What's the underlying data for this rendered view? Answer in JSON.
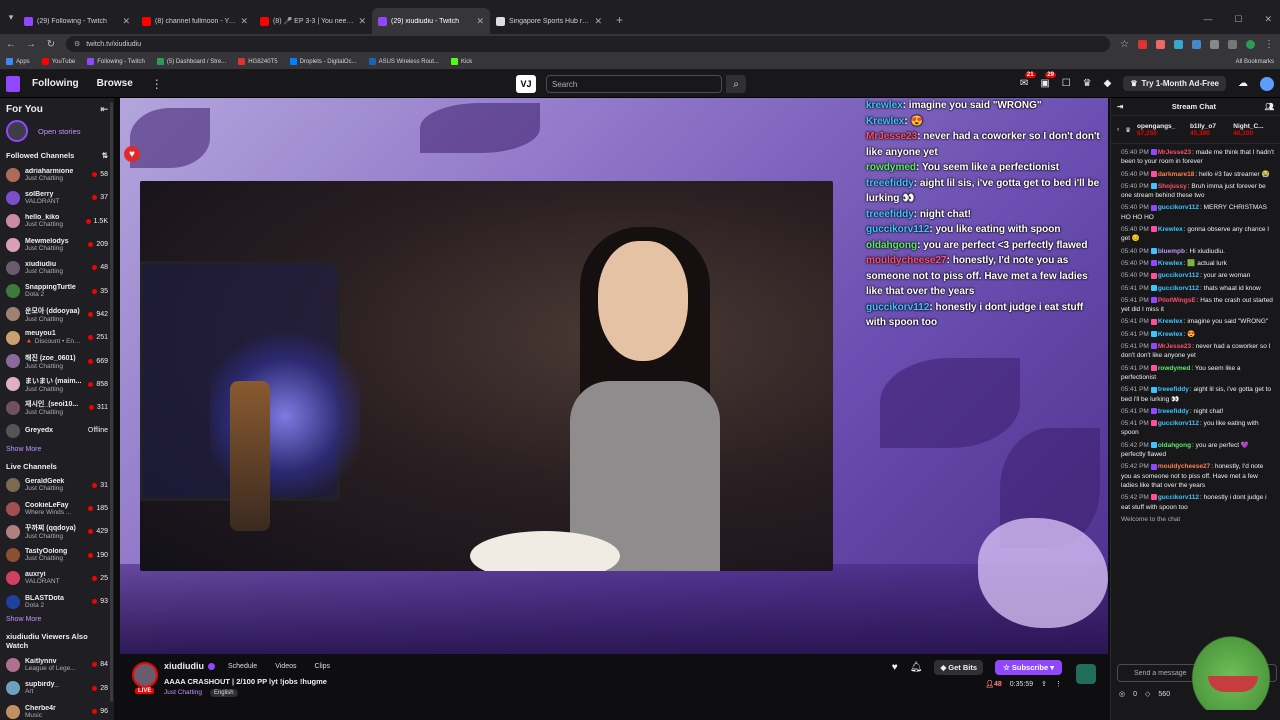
{
  "browser": {
    "tabs": [
      {
        "title": "(29) Following - Twitch",
        "color": "#9147ff",
        "active": false
      },
      {
        "title": "(8) channel fullmoon - YouTube",
        "color": "#ff0000",
        "active": false
      },
      {
        "title": "(8) 🎤 EP 3-3 | You need to l",
        "color": "#ff0000",
        "active": false
      },
      {
        "title": "(29) xiudiudiu - Twitch",
        "color": "#9147ff",
        "active": true
      },
      {
        "title": "Singapore Sports Hub rename",
        "color": "#dddddd",
        "active": false
      }
    ],
    "url": "twitch.tv/xiudiudiu",
    "bookmarks": [
      {
        "label": "Apps",
        "color": "#4285f4"
      },
      {
        "label": "YouTube",
        "color": "#ff0000"
      },
      {
        "label": "Following - Twitch",
        "color": "#9147ff"
      },
      {
        "label": "(5) Dashboard / Stre...",
        "color": "#2d9b55"
      },
      {
        "label": "HG8240T5",
        "color": "#d33"
      },
      {
        "label": "Droplets - DigitalOc...",
        "color": "#0080ff"
      },
      {
        "label": "ASUS Wireless Rout...",
        "color": "#1d63ae"
      },
      {
        "label": "Kick",
        "color": "#53fc18"
      }
    ],
    "all_bookmarks": "All Bookmarks"
  },
  "topnav": {
    "following": "Following",
    "browse": "Browse",
    "vj": "VJ",
    "search_placeholder": "Search",
    "notif_badge_1": "21",
    "notif_badge_2": "29",
    "prime": "Try 1-Month Ad-Free"
  },
  "sidebar": {
    "for_you": "For You",
    "open_stories": "Open stories",
    "followed_title": "Followed Channels",
    "followed": [
      {
        "name": "adriaharmione",
        "cat": "Just Chatting",
        "viewers": "58",
        "color": "#b06a5a"
      },
      {
        "name": "soIBerry",
        "cat": "VALORANT",
        "viewers": "37",
        "color": "#7a4fc9"
      },
      {
        "name": "hello_kiko",
        "cat": "Just Chatting",
        "viewers": "1.5K",
        "color": "#c98ca0"
      },
      {
        "name": "Mewmelodys",
        "cat": "Just Chatting",
        "viewers": "209",
        "color": "#d9a0b5"
      },
      {
        "name": "xiudiudiu",
        "cat": "Just Chatting",
        "viewers": "48",
        "color": "#6b5b6e"
      },
      {
        "name": "SnappingTurtle",
        "cat": "Dota 2",
        "viewers": "35",
        "color": "#3f7a3c"
      },
      {
        "name": "운모아 (ddooyaa)",
        "cat": "Just Chatting",
        "viewers": "942",
        "color": "#a08070"
      },
      {
        "name": "meuyou1",
        "cat": "🔺 Discount • Ends in 1d",
        "viewers": "251",
        "color": "#c9a070"
      },
      {
        "name": "해진 (zoe_0601)",
        "cat": "Just Chatting",
        "viewers": "669",
        "color": "#8a6a9a"
      },
      {
        "name": "まいまい (maim...",
        "cat": "Just Chatting",
        "viewers": "858",
        "color": "#e0b0c0"
      },
      {
        "name": "재시인_(seoi10...",
        "cat": "Just Chatting",
        "viewers": "311",
        "color": "#705060"
      },
      {
        "name": "Greyedx",
        "cat": "",
        "viewers": "Offline",
        "color": "#555555"
      }
    ],
    "show_more_1": "Show More",
    "live_title": "Live Channels",
    "live": [
      {
        "name": "GeraldGeek",
        "cat": "Just Chatting",
        "viewers": "31",
        "color": "#7a6a50"
      },
      {
        "name": "CookieLeFay",
        "cat": "Where Winds ...",
        "viewers": "185",
        "color": "#a05050"
      },
      {
        "name": "꾸까찌 (qqdoya)",
        "cat": "Just Chatting",
        "viewers": "429",
        "color": "#b08080"
      },
      {
        "name": "TastyOolong",
        "cat": "Just Chatting",
        "viewers": "190",
        "color": "#8a5030"
      },
      {
        "name": "auxryi",
        "cat": "VALORANT",
        "viewers": "25",
        "color": "#d04060"
      },
      {
        "name": "BLASTDota",
        "cat": "Dota 2",
        "viewers": "93",
        "color": "#2040a0"
      }
    ],
    "show_more_2": "Show More",
    "also_title": "xiudiudiu Viewers Also Watch",
    "also": [
      {
        "name": "Kaitlynnv",
        "cat": "League of Lege...",
        "viewers": "84",
        "color": "#b07090"
      },
      {
        "name": "supbirdy_",
        "cat": "Art",
        "viewers": "28",
        "color": "#70a0c0"
      },
      {
        "name": "Cherbe4r",
        "cat": "Music",
        "viewers": "96",
        "color": "#c09060"
      }
    ]
  },
  "overlay_chat": [
    {
      "name": "krewlex",
      "text": ": imagine you said \"WRONG\"",
      "cls": ""
    },
    {
      "name": "Krewlex",
      "text": ": 😍",
      "cls": ""
    },
    {
      "name": "MrJesse23",
      "text": ": never had a coworker so I don't don't like anyone yet",
      "cls": "red"
    },
    {
      "name": "rowdymed",
      "text": ": You seem like a perfectionist",
      "cls": "green"
    },
    {
      "name": "treeefiddy",
      "text": ": aight lil sis, i've gotta get to bed i'll be lurking 👀",
      "cls": ""
    },
    {
      "name": "treeefiddy",
      "text": ": night chat!",
      "cls": ""
    },
    {
      "name": "guccikorv112",
      "text": ": you like eating with spoon",
      "cls": ""
    },
    {
      "name": "oldahgong",
      "text": ": you are perfect <3 perfectly flawed",
      "cls": "green"
    },
    {
      "name": "mouldycheese27",
      "text": ": honestly, I'd note you as someone not to piss off. Have met a few ladies like that over the years",
      "cls": "red"
    },
    {
      "name": "guccikorv112",
      "text": ": honestly i dont judge i eat stuff with spoon too",
      "cls": ""
    }
  ],
  "stream": {
    "streamer": "xiudiudiu",
    "schedule": "Schedule",
    "videos": "Videos",
    "clips": "Clips",
    "title": "AAAA CRASHOUT | 2/100 PP lyt !jobs !hugme",
    "category": "Just Chatting",
    "language": "English",
    "live": "LIVE",
    "get_bits": "Get Bits",
    "subscribe": "Subscribe",
    "viewers": "48",
    "uptime": "0:35:59"
  },
  "chat": {
    "header": "Stream Chat",
    "leaderboard": [
      {
        "name": "opengangs_",
        "value": "57,250"
      },
      {
        "name": "b1lly_o7",
        "value": "45,390"
      },
      {
        "name": "Night_C...",
        "value": "40,100"
      }
    ],
    "messages": [
      {
        "time": "05:40 PM",
        "user": "MrJesse23",
        "color": "#ff4f6a",
        "text": ": made me think that I hadn't been to your room in forever"
      },
      {
        "time": "05:40 PM",
        "user": "darkmare18",
        "color": "#ff7f50",
        "text": ": hello #3 fav streamer 😭"
      },
      {
        "time": "05:40 PM",
        "user": "Shojussy",
        "color": "#ff4f6a",
        "text": ": Bruh imma just forever be one stream behind these two"
      },
      {
        "time": "05:40 PM",
        "user": "guccikorv112",
        "color": "#3ec3ff",
        "text": ": MERRY CHRISTMAS HO HO HO"
      },
      {
        "time": "05:40 PM",
        "user": "Krewlex",
        "color": "#3ec3ff",
        "text": ": gonna observe any chance I get 😊"
      },
      {
        "time": "05:40 PM",
        "user": "bluempb",
        "color": "#bf94ff",
        "text": ": Hi xiudiudiu."
      },
      {
        "time": "05:40 PM",
        "user": "Krewlex",
        "color": "#3ec3ff",
        "text": ": 🟩 actual lurk"
      },
      {
        "time": "05:40 PM",
        "user": "guccikorv112",
        "color": "#3ec3ff",
        "text": ": your are woman"
      },
      {
        "time": "05:41 PM",
        "user": "guccikorv112",
        "color": "#3ec3ff",
        "text": ": thats whaat id know"
      },
      {
        "time": "05:41 PM",
        "user": "PilotWingsE",
        "color": "#ff4f6a",
        "text": ": Has the crash out started yet did I miss it"
      },
      {
        "time": "05:41 PM",
        "user": "Krewlex",
        "color": "#3ec3ff",
        "text": ": imagine you said \"WRONG\""
      },
      {
        "time": "05:41 PM",
        "user": "Krewlex",
        "color": "#3ec3ff",
        "text": ": 😍"
      },
      {
        "time": "05:41 PM",
        "user": "MrJesse23",
        "color": "#ff4f6a",
        "text": ": never had a coworker so I don't don't like anyone yet"
      },
      {
        "time": "05:41 PM",
        "user": "rowdymed",
        "color": "#5ee86b",
        "text": ": You seem like a perfectionist"
      },
      {
        "time": "05:41 PM",
        "user": "treeefiddy",
        "color": "#3ec3ff",
        "text": ": aight lil sis, i've gotta get to bed i'll be lurking 👀"
      },
      {
        "time": "05:41 PM",
        "user": "treeefiddy",
        "color": "#3ec3ff",
        "text": ": night chat!"
      },
      {
        "time": "05:41 PM",
        "user": "guccikorv112",
        "color": "#3ec3ff",
        "text": ": you like eating with spoon"
      },
      {
        "time": "05:42 PM",
        "user": "oldahgong",
        "color": "#5ee86b",
        "text": ": you are perfect 💜 perfectly flawed"
      },
      {
        "time": "05:42 PM",
        "user": "mouldycheese27",
        "color": "#ff7f50",
        "text": ": honestly, I'd note you as someone not to piss off. Have met a few ladies like that over the years"
      },
      {
        "time": "05:42 PM",
        "user": "guccikorv112",
        "color": "#3ec3ff",
        "text": ": honestly i dont judge i eat stuff with spoon too"
      }
    ],
    "welcome": "Welcome to the chat",
    "placeholder": "Send a message",
    "points": "0",
    "points2": "560"
  }
}
